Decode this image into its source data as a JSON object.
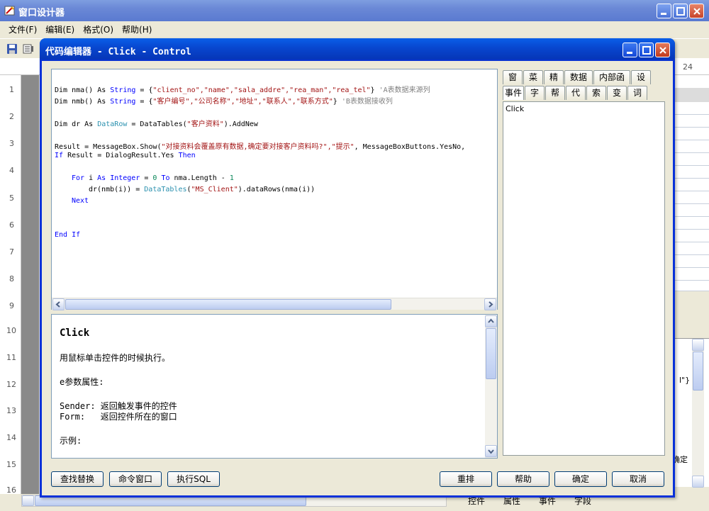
{
  "back_window": {
    "title": "窗口设计器",
    "menu": [
      {
        "label": "文件(F)"
      },
      {
        "label": "编辑(E)"
      },
      {
        "label": "格式(O)"
      },
      {
        "label": "帮助(H)"
      }
    ],
    "ruler_top_label": "24",
    "ruler_left": [
      "1",
      "2",
      "3",
      "4",
      "5",
      "6",
      "7",
      "8",
      "9",
      "10",
      "11",
      "12",
      "13",
      "14",
      "15",
      "16"
    ],
    "right_snippet_1": "l\"}",
    "right_snippet_2": "确定",
    "bottom_tabs": [
      "控件",
      "属性",
      "事件",
      "字段"
    ]
  },
  "code_window": {
    "title": "代码编辑器 - Click - Control",
    "code": {
      "l1_a": "Dim nma() As ",
      "l1_kw": "String",
      "l1_b": " = {",
      "l1_s": "\"client_no\",\"name\",\"sala_addre\",\"rea_man\",\"rea_tel\"",
      "l1_c": "} ",
      "l1_cm": "'A表数据来源列",
      "l2_a": "Dim nmb() As ",
      "l2_kw": "String",
      "l2_b": " = {",
      "l2_s": "\"客户编号\",\"公司名称\",\"地址\",\"联系人\",\"联系方式\"",
      "l2_c": "} ",
      "l2_cm": "'B表数据接收列",
      "l3_a": "Dim dr As ",
      "l3_ty": "DataRow",
      "l3_b": " = DataTables(",
      "l3_s": "\"客户资料\"",
      "l3_c": ").AddNew",
      "l4_a": "Result = MessageBox.Show(",
      "l4_s": "\"对接资料会覆盖原有数据,确定要对接客户资料吗?\",\"提示\"",
      "l4_b": ", MessageBoxButtons.YesNo,",
      "l5_kw1": "If",
      "l5_a": " Result = DialogResult.Yes ",
      "l5_kw2": "Then",
      "l6_kw1": "For",
      "l6_a": " i ",
      "l6_kw2": "As",
      "l6_b": " ",
      "l6_kw3": "Integer",
      "l6_c": " = ",
      "l6_n1": "0",
      "l6_d": " ",
      "l6_kw4": "To",
      "l6_e": " nma.Length - ",
      "l6_n2": "1",
      "l7_a": "dr(nmb(i)) = ",
      "l7_ty": "DataTables",
      "l7_b": "(",
      "l7_s": "\"MS_Client\"",
      "l7_c": ").dataRows(nma(i))",
      "l8_kw": "Next",
      "l9_kw": "End If"
    },
    "help": {
      "title": "Click",
      "line1": "用鼠标单击控件的时候执行。",
      "line2": "e参数属性:",
      "line3": "Sender: 返回触发事件的控件",
      "line4": "Form:   返回控件所在的窗口",
      "line5": "示例:"
    },
    "side_tabs_row1": [
      "窗口",
      "菜单",
      "精灵",
      "数据源",
      "内部函数",
      "设置"
    ],
    "side_tabs_row2": [
      "事件",
      "字段",
      "帮助",
      "代码",
      "索引",
      "变量",
      "词汇"
    ],
    "side_list": [
      "Click"
    ],
    "buttons": {
      "find_replace": "查找替换",
      "command_window": "命令窗口",
      "exec_sql": "执行SQL",
      "rearrange": "重排",
      "help": "帮助",
      "ok": "确定",
      "cancel": "取消"
    }
  }
}
